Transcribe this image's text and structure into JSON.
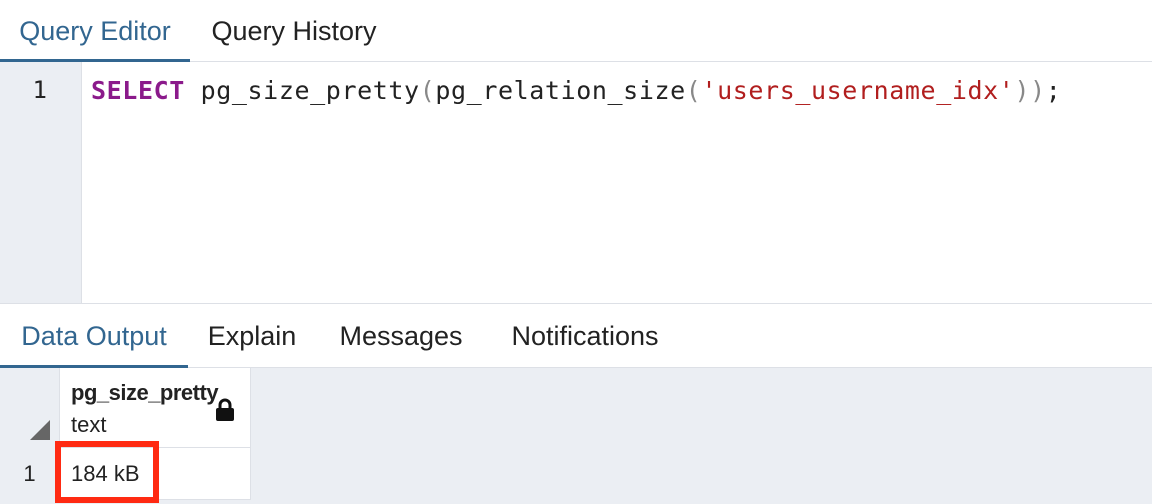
{
  "top_tabs": {
    "query_editor": "Query Editor",
    "query_history": "Query History"
  },
  "editor": {
    "line_number": "1",
    "code": {
      "keyword": "SELECT",
      "fn_outer": "pg_size_pretty",
      "fn_inner": "pg_relation_size",
      "open_paren": "(",
      "close_paren": ")",
      "string_literal": "'users_username_idx'",
      "terminator": ";"
    }
  },
  "bottom_tabs": {
    "data_output": "Data Output",
    "explain": "Explain",
    "messages": "Messages",
    "notifications": "Notifications"
  },
  "grid": {
    "column": {
      "name": "pg_size_pretty",
      "type": "text"
    },
    "rows": [
      {
        "row_number": "1",
        "value": "184 kB"
      }
    ]
  },
  "colors": {
    "accent": "#326690",
    "keyword": "#8b1a8b",
    "string": "#b11e1e",
    "highlight": "#ff2a12"
  },
  "icons": {
    "column_locked": "lock-icon",
    "sort": "sort-triangle-icon"
  }
}
